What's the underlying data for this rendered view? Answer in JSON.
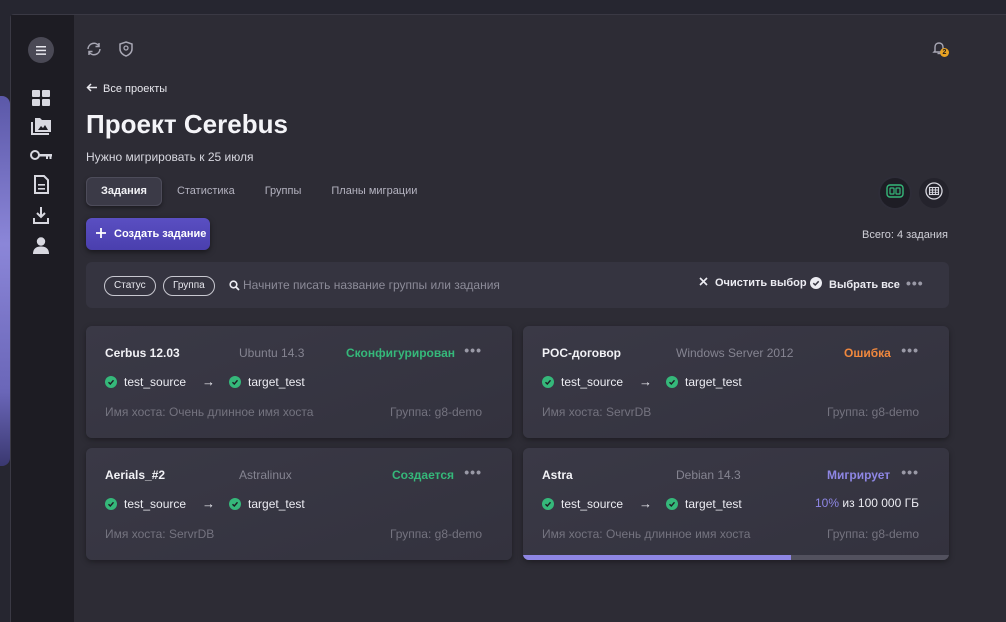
{
  "sidebar": {
    "menu_icon": "menu-icon",
    "items": [
      {
        "icon": "dashboard-icon"
      },
      {
        "icon": "folder-images-icon"
      },
      {
        "icon": "key-icon"
      },
      {
        "icon": "document-icon"
      },
      {
        "icon": "download-icon"
      },
      {
        "icon": "user-icon"
      }
    ]
  },
  "topbar": {
    "icons": [
      "refresh-icon",
      "shield-icon"
    ],
    "notifications_count": "2"
  },
  "back_label": "Все проекты",
  "title": "Проект Cerebus",
  "subtitle": "Нужно мигрировать к 25 июля",
  "tabs": [
    "Задания",
    "Статистика",
    "Группы",
    "Планы миграции"
  ],
  "create_label": "Создать задание",
  "total_label": "Всего: 4 задания",
  "filters": {
    "chips": [
      "Статус",
      "Группа"
    ],
    "search_placeholder": "Начните писать название группы или задания",
    "clear_label": "Очистить выбор",
    "select_all_label": "Выбрать все",
    "more_label": "•••"
  },
  "colors": {
    "accent": "#5a4fc2",
    "success": "#35b87a",
    "status_configured": "#35b87a",
    "status_creating": "#35b87a",
    "status_error": "#f0883e",
    "status_migrating": "#8e86e4"
  },
  "cards": [
    {
      "name": "Cerbus 12.03",
      "os": "Ubuntu 14.3",
      "status": "Сконфигурирован",
      "status_color": "#35b87a",
      "source": "test_source",
      "target": "target_test",
      "host": "Имя хоста: Очень длинное имя хоста",
      "group": "Группа: g8-demo",
      "more": "•••"
    },
    {
      "name": "POC-договор",
      "os": "Windows Server 2012",
      "status": "Ошибка",
      "status_color": "#f0883e",
      "source": "test_source",
      "target": "target_test",
      "host": "Имя хоста: ServrDB",
      "group": "Группа: g8-demo",
      "more": "•••"
    },
    {
      "name": "Aerials_#2",
      "os": "Astralinux",
      "status": "Создается",
      "status_color": "#35b87a",
      "source": "test_source",
      "target": "target_test",
      "host": "Имя хоста: ServrDB",
      "group": "Группа: g8-demo",
      "more": "•••"
    },
    {
      "name": "Astra",
      "os": "Debian 14.3",
      "status": "Мигрирует",
      "status_color": "#8e86e4",
      "source": "test_source",
      "target": "target_test",
      "host": "Имя хоста: Очень длинное имя хоста",
      "group": "Группа: g8-demo",
      "more": "•••",
      "progress_percent": "10%",
      "progress_rest": " из 100 000 ГБ",
      "progress_fraction": 0.63
    }
  ]
}
